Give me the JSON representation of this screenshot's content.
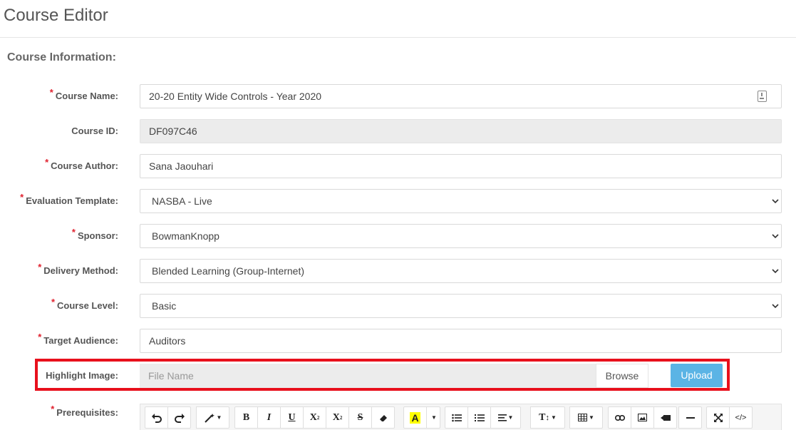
{
  "page": {
    "title": "Course Editor"
  },
  "section": {
    "title": "Course Information:"
  },
  "fields": {
    "course_name": {
      "label": "Course Name:",
      "value": "20-20 Entity Wide Controls - Year 2020",
      "required": true
    },
    "course_id": {
      "label": "Course ID:",
      "value": "DF097C46",
      "required": false
    },
    "course_author": {
      "label": "Course Author:",
      "value": "Sana Jaouhari",
      "required": true
    },
    "evaluation_template": {
      "label": "Evaluation Template:",
      "value": "NASBA - Live",
      "required": true
    },
    "sponsor": {
      "label": "Sponsor:",
      "value": "BowmanKnopp",
      "required": true
    },
    "delivery_method": {
      "label": "Delivery Method:",
      "value": "Blended Learning (Group-Internet)",
      "required": true
    },
    "course_level": {
      "label": "Course Level:",
      "value": "Basic",
      "required": true
    },
    "target_audience": {
      "label": "Target Audience:",
      "value": "Auditors",
      "required": true
    },
    "highlight_image": {
      "label": "Highlight Image:",
      "placeholder": "File Name",
      "browse_label": "Browse",
      "upload_label": "Upload"
    },
    "prerequisites": {
      "label": "Prerequisites:",
      "required": true
    }
  },
  "required_marker": "*",
  "colors": {
    "required": "#e0212e",
    "highlight_border": "#e8101c",
    "upload_button": "#5bb4e5",
    "readonly_bg": "#ececec"
  },
  "toolbar": {
    "buttons": [
      "undo-icon",
      "redo-icon",
      "magic-wand-icon",
      "bold-icon",
      "italic-icon",
      "underline-icon",
      "superscript-icon",
      "subscript-icon",
      "strikethrough-icon",
      "eraser-icon",
      "highlight-color-icon",
      "unordered-list-icon",
      "ordered-list-icon",
      "align-icon",
      "font-size-icon",
      "table-icon",
      "link-icon",
      "image-icon",
      "video-icon",
      "horizontal-rule-icon",
      "fullscreen-icon",
      "code-view-icon"
    ],
    "glyphs": {
      "bold": "B",
      "italic": "I",
      "underline": "U",
      "superscript": "X",
      "sup_small": "2",
      "subscript": "X",
      "sub_small": "2",
      "strike": "S",
      "highlight": "A",
      "font_size": "T",
      "code": "</>"
    }
  }
}
